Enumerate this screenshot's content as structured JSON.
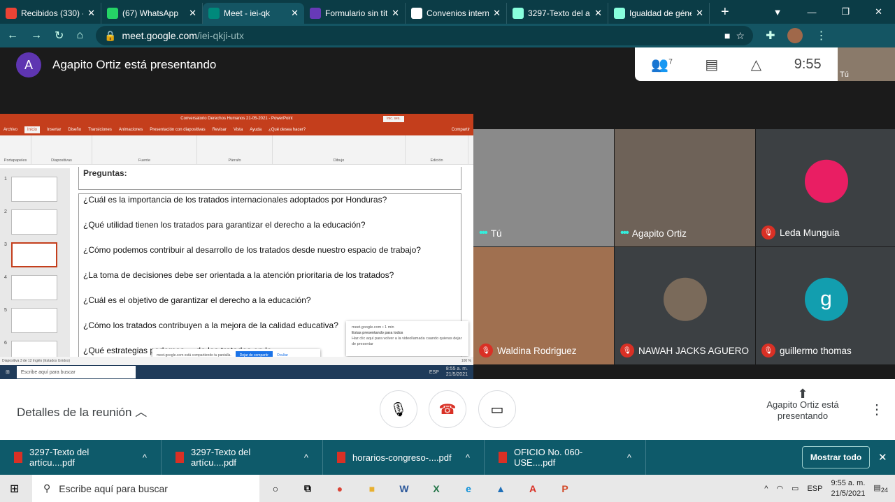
{
  "browser": {
    "tabs": [
      {
        "label": "Recibidos (330) -",
        "icon": "gmail-icon",
        "color": "#ea4335"
      },
      {
        "label": "(67) WhatsApp",
        "icon": "whatsapp-icon",
        "color": "#25d366"
      },
      {
        "label": "Meet - iei-qk",
        "icon": "meet-icon",
        "color": "#00897b",
        "active": true
      },
      {
        "label": "Formulario sin tít",
        "icon": "forms-icon",
        "color": "#673ab7"
      },
      {
        "label": "Convenios intern",
        "icon": "document-icon",
        "color": "#ffffff"
      },
      {
        "label": "3297-Texto del a",
        "icon": "globe-icon",
        "color": "#8fd"
      },
      {
        "label": "Igualdad de géne",
        "icon": "globe-icon",
        "color": "#8fd"
      }
    ],
    "url_host": "meet.google.com",
    "url_path": "/iei-qkji-utx"
  },
  "meet": {
    "presenter_initial": "A",
    "presenting_text": "Agapito Ortiz está presentando",
    "participants_count": "7",
    "time": "9:55",
    "self_label": "Tú",
    "tiles": [
      {
        "name": "Tú",
        "muted": false,
        "video": true
      },
      {
        "name": "Agapito Ortiz",
        "muted": false,
        "video": true
      },
      {
        "name": "Leda Munguia",
        "muted": true,
        "video": false
      },
      {
        "name": "Waldina Rodriguez",
        "muted": true,
        "video": true
      },
      {
        "name": "NAWAH JACKS AGUERO",
        "muted": true,
        "video": false
      },
      {
        "name": "guillermo thomas",
        "muted": true,
        "video": false,
        "initial": "g"
      }
    ],
    "details_label": "Detalles de la reunión",
    "presenter_status": "Agapito Ortiz está presentando"
  },
  "ppt": {
    "title": "Conversatorio Derechos Humanos 21-05-2021 - PowerPoint",
    "signin": "Inic. ses.",
    "menu": [
      "Archivo",
      "Inicio",
      "Insertar",
      "Diseño",
      "Transiciones",
      "Animaciones",
      "Presentación con diapositivas",
      "Revisar",
      "Vista",
      "Ayuda",
      "¿Qué desea hacer?"
    ],
    "share": "Compartir",
    "groups": [
      "Portapapeles",
      "Diapositivas",
      "Fuente",
      "Párrafo",
      "Dibujo",
      "Edición"
    ],
    "slide_heading": "Preguntas:",
    "questions": [
      "¿Cuál es la importancia de los tratados internacionales adoptados por Honduras?",
      "¿Qué utilidad tienen los tratados para garantizar el derecho a la educación?",
      "¿Cómo podemos contribuir al desarrollo de los tratados desde nuestro espacio de trabajo?",
      "¿La toma de decisiones debe ser orientada a la atención prioritaria de los tratados?",
      "¿Cuál es el objetivo de garantizar el derecho a la educación?",
      "¿Cómo los tratados contribuyen a la mejora de la calidad educativa?",
      "¿Qué estrategias podemos ... de los tratados en lo"
    ],
    "thumb_numbers": [
      "1",
      "2",
      "3",
      "4",
      "5",
      "6"
    ],
    "share_bar": {
      "text": "meet.google.com está compartiendo tu pantalla.",
      "stop": "Dejar de compartir",
      "hide": "Ocultar"
    },
    "notification": {
      "source": "meet.google.com • 1 min",
      "title": "Estas presentando para todos",
      "body": "Haz clic aquí para volver a la videollamada cuando quieras dejar de presentar"
    },
    "status": "Diapositiva 3 de 12   Inglés (Estados Unidos)",
    "zoom": "100 %",
    "taskbar": {
      "search": "Escribe aquí para buscar",
      "time": "8:55 a. m.",
      "date": "21/5/2021",
      "lang": "ESP"
    }
  },
  "downloads": {
    "items": [
      "3297-Texto del artícu....pdf",
      "3297-Texto del artícu....pdf",
      "horarios-congreso-....pdf",
      "OFICIO No. 060-USE....pdf"
    ],
    "show_all": "Mostrar todo"
  },
  "taskbar": {
    "search_placeholder": "Escribe aquí para buscar",
    "lang": "ESP",
    "time": "9:55 a. m.",
    "date": "21/5/2021",
    "notifications": "24"
  }
}
